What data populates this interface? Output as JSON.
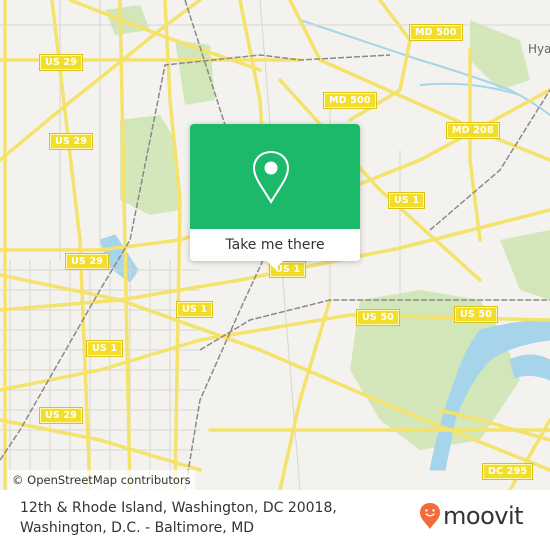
{
  "map": {
    "route_shields": [
      {
        "label": "US 29"
      },
      {
        "label": "US 29"
      },
      {
        "label": "US 29"
      },
      {
        "label": "US 29"
      },
      {
        "label": "US 1"
      },
      {
        "label": "US 1"
      },
      {
        "label": "US 1"
      },
      {
        "label": "US 1"
      },
      {
        "label": "MD 500"
      },
      {
        "label": "MD 500"
      },
      {
        "label": "MD 208"
      },
      {
        "label": "US 50"
      },
      {
        "label": "US 50"
      },
      {
        "label": "DC 295"
      }
    ],
    "place_labels": [
      {
        "label": "Hya"
      }
    ],
    "attribution": "© OpenStreetMap contributors"
  },
  "popup": {
    "icon": "location-pin-icon",
    "button_label": "Take me there",
    "accent_color": "#1db96b"
  },
  "footer": {
    "address_line1": "12th & Rhode Island, Washington, DC 20018,",
    "address_line2": "Washington, D.C. - Baltimore, MD",
    "brand": "moovit",
    "brand_color": "#f26b3a"
  }
}
